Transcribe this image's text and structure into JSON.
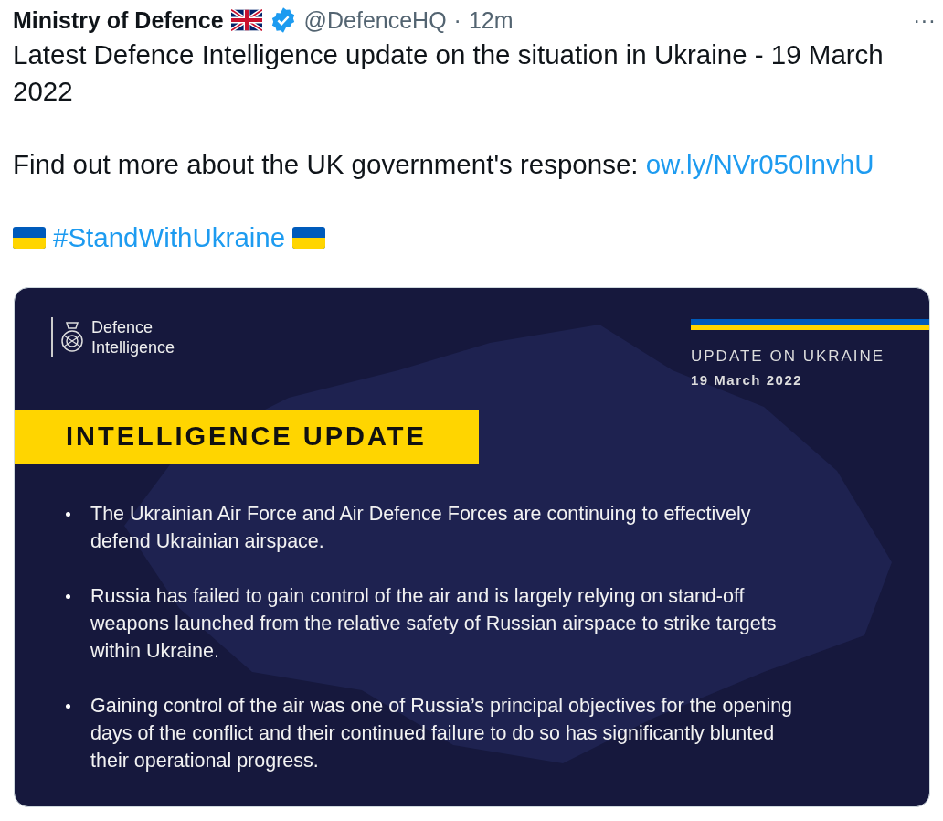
{
  "tweet": {
    "author": "Ministry of Defence",
    "handle": "@DefenceHQ",
    "separator": "·",
    "time": "12m",
    "more": "···",
    "paragraphs": [
      {
        "kind": "text",
        "text": "Latest Defence Intelligence update on the situation in Ukraine - 19 March 2022"
      },
      {
        "kind": "link",
        "text": "Find out more about the UK government's response: ",
        "link": "ow.ly/NVr050InvhU"
      },
      {
        "kind": "hashtag",
        "text": "#StandWithUkraine"
      }
    ]
  },
  "card": {
    "logo": [
      "Defence",
      "Intelligence"
    ],
    "banner_title": "UPDATE ON UKRAINE",
    "banner_date": "19 March 2022",
    "heading": "INTELLIGENCE UPDATE",
    "bullets": [
      "The Ukrainian Air Force and Air Defence Forces are continuing to effectively defend Ukrainian airspace.",
      "Russia has failed to gain control of the air and is largely relying on stand-off weapons launched from the relative safety of Russian airspace to strike targets within Ukraine.",
      "Gaining control of the air was one of Russia’s principal objectives for the opening days of the conflict and their continued failure to do so has significantly blunted their operational progress."
    ]
  }
}
